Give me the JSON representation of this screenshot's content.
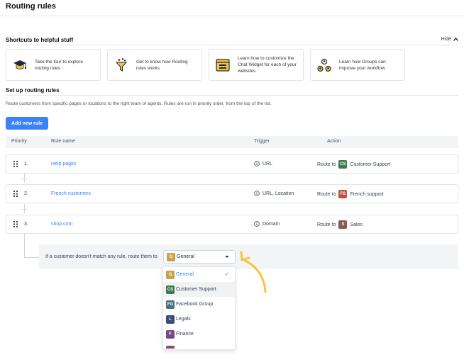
{
  "page": {
    "title": "Routing rules"
  },
  "shortcuts": {
    "title": "Shortcuts to helpful stuff",
    "hide_label": "Hide",
    "cards": [
      {
        "icon": "graduation-cap-icon",
        "text": "Take the tour to explore routing rules"
      },
      {
        "icon": "funnel-icon",
        "text": "Get to know how Routing rules works"
      },
      {
        "icon": "chat-widget-icon",
        "text": "Learn how to customize the Chat Widget for each of your websites"
      },
      {
        "icon": "groups-icon",
        "text": "Learn how Groups can improve your workflow"
      }
    ]
  },
  "setup": {
    "title": "Set up routing rules",
    "description": "Route customers from specific pages or locations to the right team of agents. Rules are run in priority order, from the top of the list.",
    "add_button": "Add new rule"
  },
  "table": {
    "headers": {
      "priority": "Priority",
      "rule_name": "Rule name",
      "trigger": "Trigger",
      "action": "Action"
    },
    "rules": [
      {
        "priority": "1.",
        "name": "Help pages",
        "trigger": "URL",
        "action_prefix": "Route to",
        "group_badge": "CS",
        "badge_color": "#3f7a4f",
        "group": "Customer Support"
      },
      {
        "priority": "2.",
        "name": "French customers",
        "trigger": "URL, Location",
        "action_prefix": "Route to",
        "group_badge": "FS",
        "badge_color": "#c0523e",
        "group": "French support"
      },
      {
        "priority": "3.",
        "name": "shop.com",
        "trigger": "Domain",
        "action_prefix": "Route to",
        "group_badge": "S",
        "badge_color": "#8a5a52",
        "group": "Sales"
      }
    ]
  },
  "fallback": {
    "text": "If a customer doesn't match any rule, route them to",
    "selected_badge": "G",
    "selected_color": "#c9a34a",
    "selected": "General"
  },
  "dropdown": {
    "options": [
      {
        "badge": "G",
        "color": "#c9a34a",
        "label": "General",
        "selected": true,
        "check": "✓"
      },
      {
        "badge": "CS",
        "color": "#3f7a4f",
        "label": "Customer Support",
        "hovered": true
      },
      {
        "badge": "FG",
        "color": "#4a6f80",
        "label": "Facebook Group"
      },
      {
        "badge": "L",
        "color": "#3a4a7a",
        "label": "Legals"
      },
      {
        "badge": "F",
        "color": "#7a4a86",
        "label": "Finance"
      }
    ],
    "partial_color": "#8a4a6a"
  },
  "colors": {
    "accent": "#3b82f6",
    "arrow": "#f5c542"
  }
}
